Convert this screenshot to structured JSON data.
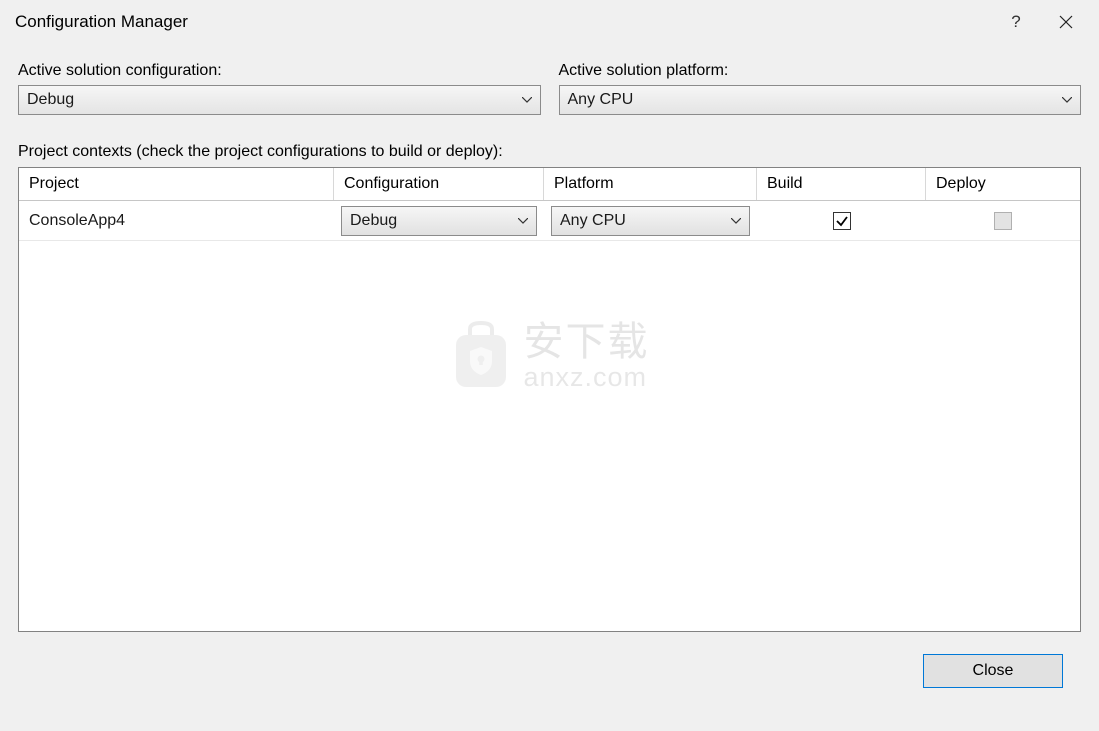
{
  "titlebar": {
    "title": "Configuration Manager"
  },
  "activeConfig": {
    "label": "Active solution configuration:",
    "value": "Debug"
  },
  "activePlatform": {
    "label": "Active solution platform:",
    "value": "Any CPU"
  },
  "contextsLabel": "Project contexts (check the project configurations to build or deploy):",
  "columns": {
    "project": "Project",
    "configuration": "Configuration",
    "platform": "Platform",
    "build": "Build",
    "deploy": "Deploy"
  },
  "rows": [
    {
      "project": "ConsoleApp4",
      "configuration": "Debug",
      "platform": "Any CPU",
      "build": true,
      "deployEnabled": false
    }
  ],
  "watermark": {
    "cn": "安下载",
    "en": "anxz.com"
  },
  "footer": {
    "close": "Close"
  }
}
